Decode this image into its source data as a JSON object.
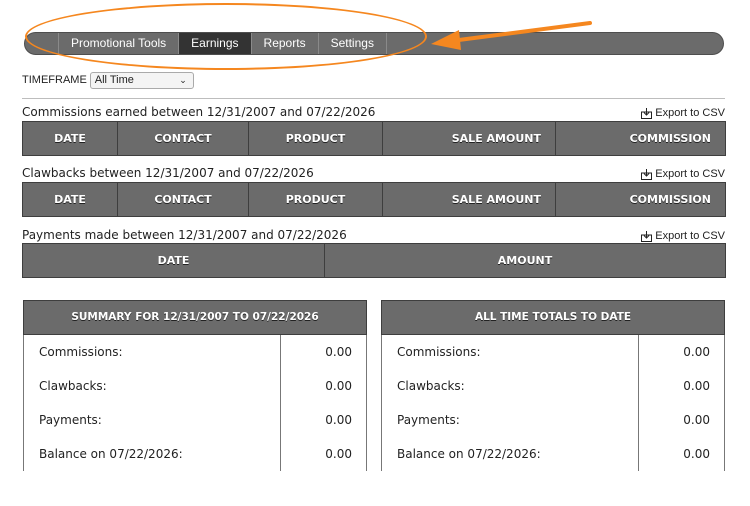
{
  "nav": {
    "tabs": [
      "Promotional Tools",
      "Earnings",
      "Reports",
      "Settings"
    ],
    "active": "Earnings"
  },
  "timeframe": {
    "label": "TIMEFRAME",
    "selected": "All Time"
  },
  "export_label": "Export to CSV",
  "commissions": {
    "title": "Commissions earned between 12/31/2007 and 07/22/2026",
    "columns": [
      "DATE",
      "CONTACT",
      "PRODUCT",
      "SALE AMOUNT",
      "COMMISSION"
    ]
  },
  "clawbacks": {
    "title": "Clawbacks between 12/31/2007 and 07/22/2026",
    "columns": [
      "DATE",
      "CONTACT",
      "PRODUCT",
      "SALE AMOUNT",
      "COMMISSION"
    ]
  },
  "payments": {
    "title": "Payments made between 12/31/2007 and 07/22/2026",
    "columns": [
      "DATE",
      "AMOUNT"
    ]
  },
  "summary": {
    "title": "SUMMARY FOR 12/31/2007 TO 07/22/2026",
    "rows": [
      {
        "label": "Commissions:",
        "value": "0.00"
      },
      {
        "label": "Clawbacks:",
        "value": "0.00"
      },
      {
        "label": "Payments:",
        "value": "0.00"
      },
      {
        "label": "Balance on 07/22/2026:",
        "value": "0.00"
      }
    ]
  },
  "totals": {
    "title": "ALL TIME TOTALS TO DATE",
    "rows": [
      {
        "label": "Commissions:",
        "value": "0.00"
      },
      {
        "label": "Clawbacks:",
        "value": "0.00"
      },
      {
        "label": "Payments:",
        "value": "0.00"
      },
      {
        "label": "Balance on 07/22/2026:",
        "value": "0.00"
      }
    ]
  },
  "colors": {
    "header_gray": "#6b6b6b",
    "active_tab": "#333333",
    "annotation": "#f5871f"
  },
  "icons": [
    "download-icon",
    "chevron-down-icon"
  ]
}
